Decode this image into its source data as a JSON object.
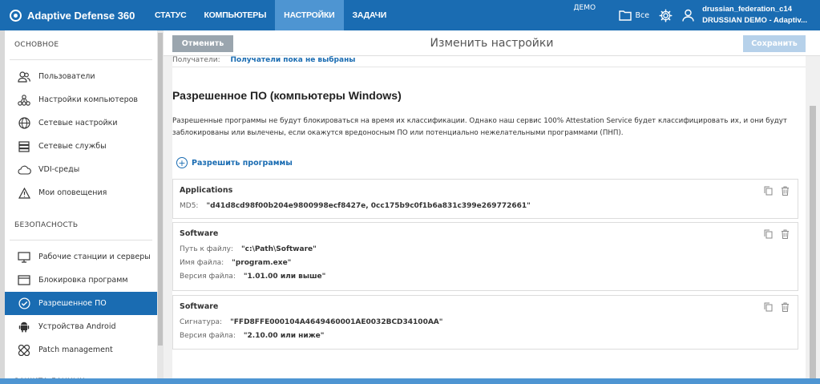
{
  "topbar": {
    "brand": "Adaptive Defense 360",
    "nav": [
      "СТАТУС",
      "КОМПЬЮТЕРЫ",
      "НАСТРОЙКИ",
      "ЗАДАЧИ"
    ],
    "active_index": 2,
    "demo_label": "ДЕМО",
    "folder_label": "Все",
    "user_line1": "drussian_federation_c14",
    "user_line2": "DRUSSIAN DEMO - Adaptiv..."
  },
  "sidebar": {
    "section1": "ОСНОВНОЕ",
    "main_items": [
      {
        "label": "Пользователи",
        "icon": "users-icon"
      },
      {
        "label": "Настройки компьютеров",
        "icon": "network-nodes-icon"
      },
      {
        "label": "Сетевые настройки",
        "icon": "globe-icon"
      },
      {
        "label": "Сетевые службы",
        "icon": "server-icon"
      },
      {
        "label": "VDI-среды",
        "icon": "vdi-cloud-icon"
      },
      {
        "label": "Мои оповещения",
        "icon": "warning-icon"
      }
    ],
    "section2": "БЕЗОПАСНОСТЬ",
    "security_items": [
      {
        "label": "Рабочие станции и серверы",
        "icon": "monitor-icon"
      },
      {
        "label": "Блокировка программ",
        "icon": "window-icon"
      },
      {
        "label": "Разрешенное ПО",
        "icon": "check-circle-icon"
      },
      {
        "label": "Устройства Android",
        "icon": "android-icon"
      },
      {
        "label": "Patch management",
        "icon": "patch-icon"
      }
    ],
    "active_label": "Разрешенное ПО",
    "section3": "ЗАЩИТА ДАННЫХ"
  },
  "header": {
    "cancel": "Отменить",
    "title": "Изменить настройки",
    "save": "Сохранить"
  },
  "recipients": {
    "label": "Получатели:",
    "value": "Получатели пока не выбраны"
  },
  "section": {
    "title": "Разрешенное ПО (компьютеры Windows)",
    "description": "Разрешенные программы не будут блокироваться на время их классификации. Однако наш сервис 100% Attestation Service будет классифицировать их, и они будут заблокированы или вылечены, если окажутся вредоносным ПО или потенциально нежелательными программами (ПНП).",
    "allow_button": "Разрешить программы"
  },
  "cards": [
    {
      "name": "Applications",
      "rows": [
        {
          "key": "MD5:",
          "value": "\"d41d8cd98f00b204e9800998ecf8427e, 0cc175b9c0f1b6a831c399e269772661\""
        }
      ]
    },
    {
      "name": "Software",
      "rows": [
        {
          "key": "Путь к файлу:",
          "value": "\"c:\\Path\\Software\""
        },
        {
          "key": "Имя файла:",
          "value": "\"program.exe\""
        },
        {
          "key": "Версия файла:",
          "value": "\"1.01.00 или выше\""
        }
      ]
    },
    {
      "name": "Software",
      "rows": [
        {
          "key": "Сигнатура:",
          "value": "\"FFD8FFE000104A4649460001AE0032BCD34100AA\""
        },
        {
          "key": "Версия файла:",
          "value": "\"2.10.00 или ниже\""
        }
      ]
    }
  ],
  "colors": {
    "topbar": "#1a6cb2",
    "active_nav": "#4e95d2",
    "link": "#1a6cb2"
  }
}
